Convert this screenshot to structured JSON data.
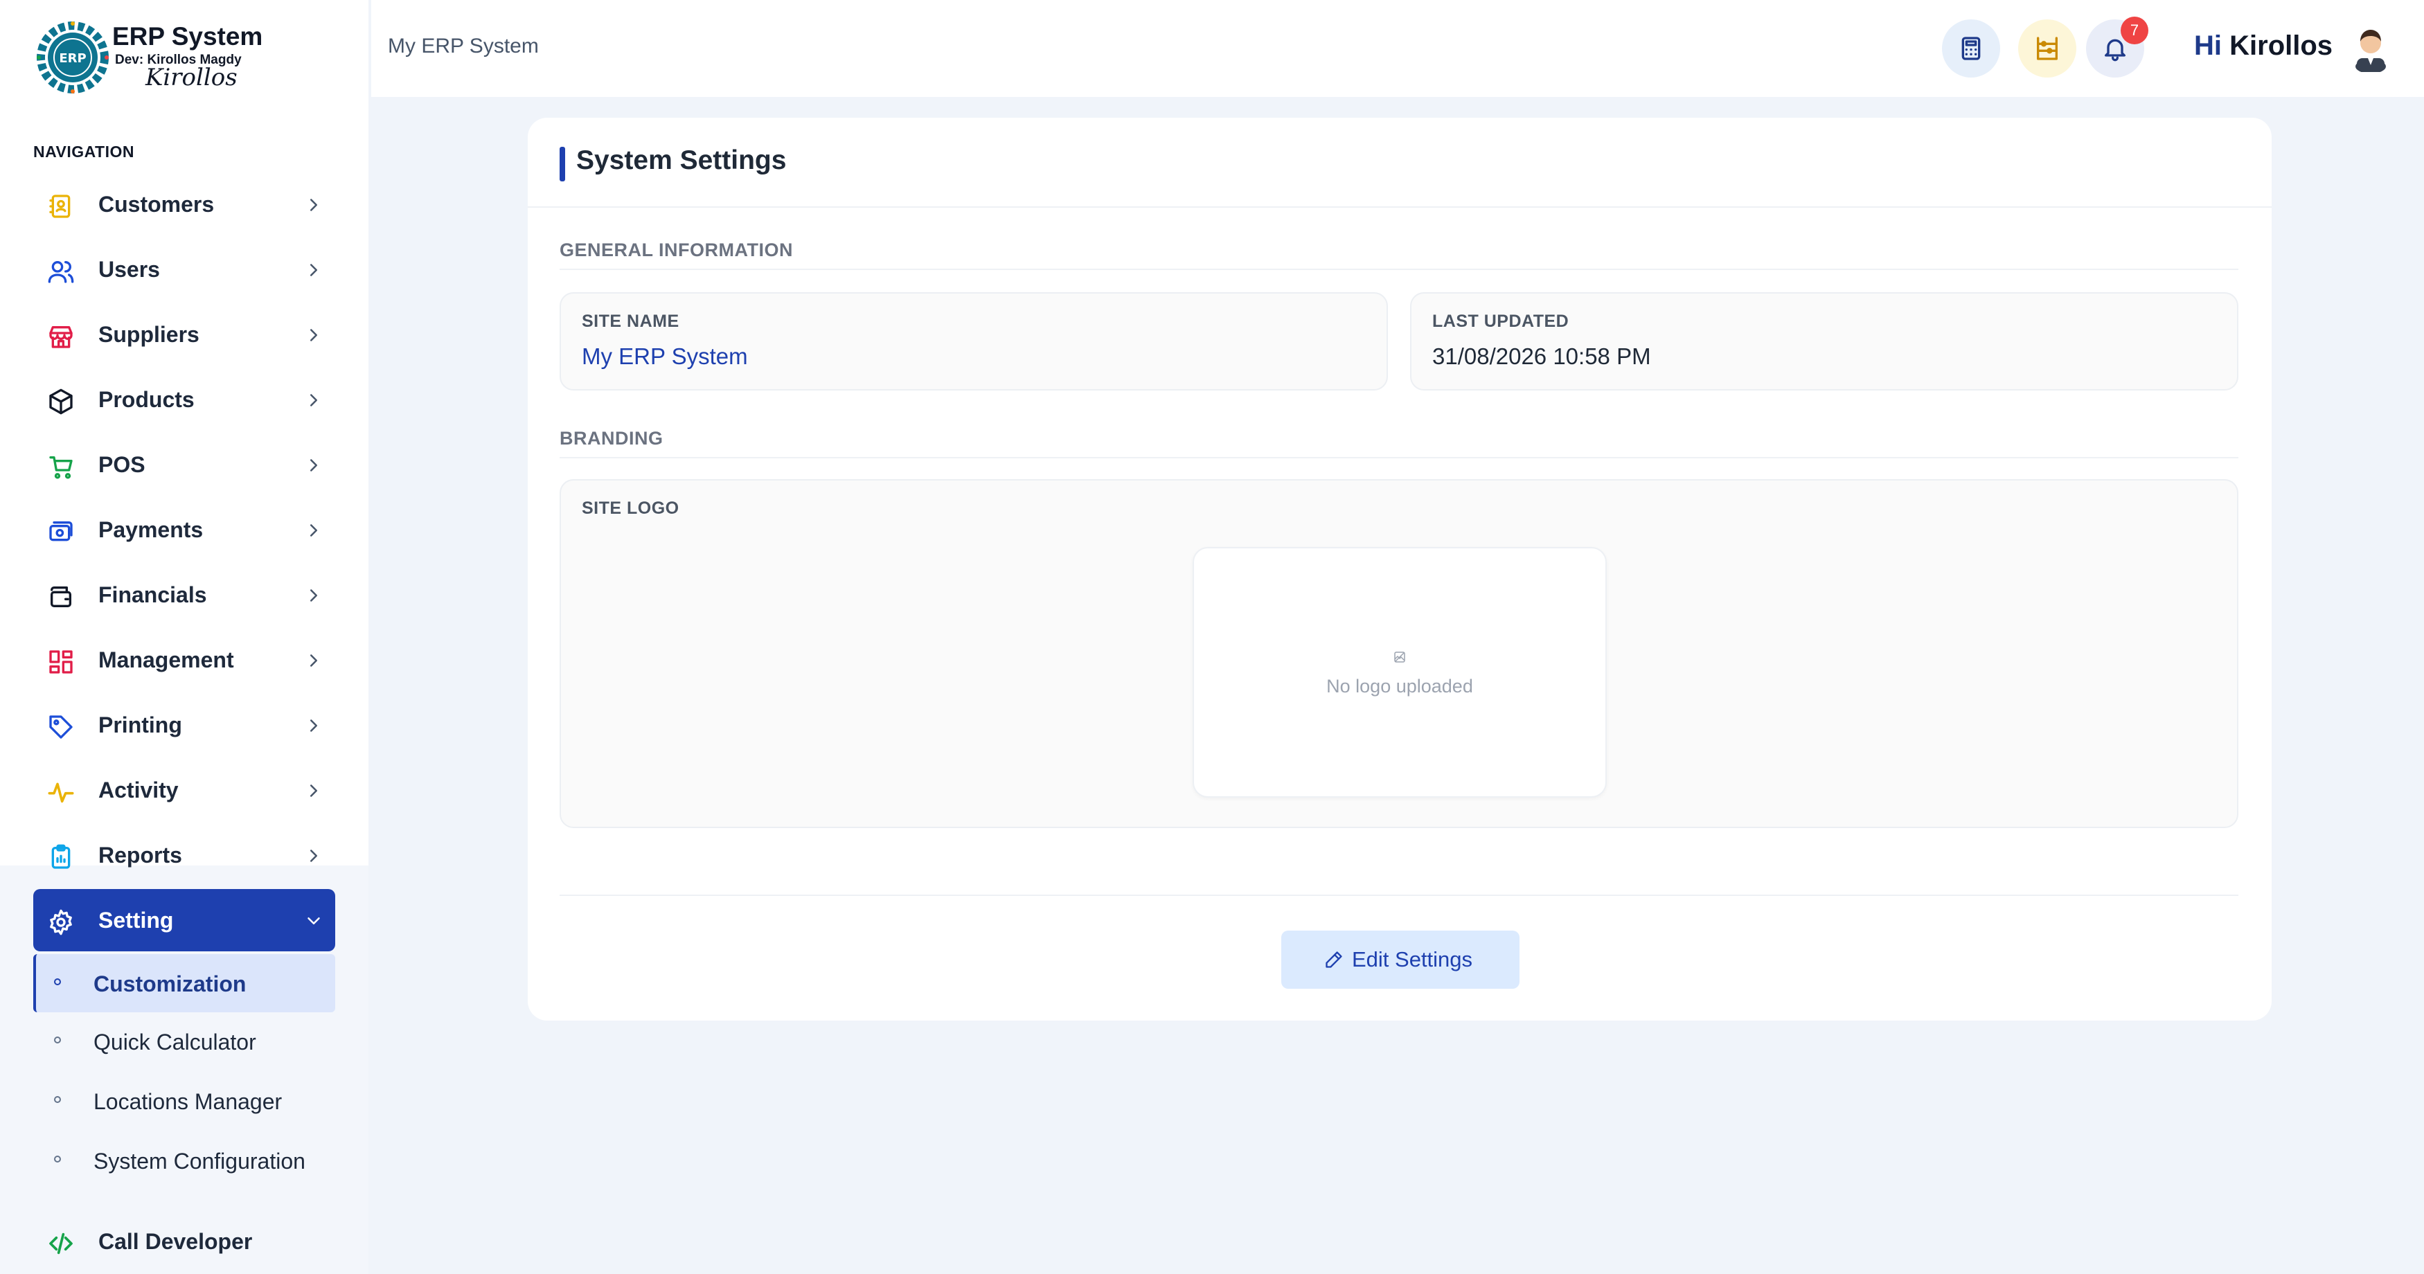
{
  "brand": {
    "title": "ERP System",
    "dev": "Dev: Kirollos Magdy",
    "signature": "Kirollos",
    "logo_text": "ERP"
  },
  "sidebar": {
    "heading": "NAVIGATION",
    "items": [
      {
        "label": "Customers",
        "icon": "contact-book-icon",
        "color": "#eab308"
      },
      {
        "label": "Users",
        "icon": "users-icon",
        "color": "#1d4ed8"
      },
      {
        "label": "Suppliers",
        "icon": "store-icon",
        "color": "#e11d48"
      },
      {
        "label": "Products",
        "icon": "box-icon",
        "color": "#111827"
      },
      {
        "label": "POS",
        "icon": "cart-icon",
        "color": "#16a34a"
      },
      {
        "label": "Payments",
        "icon": "payment-card-icon",
        "color": "#1d4ed8"
      },
      {
        "label": "Financials",
        "icon": "wallet-icon",
        "color": "#111827"
      },
      {
        "label": "Management",
        "icon": "dashboard-grid-icon",
        "color": "#e11d48"
      },
      {
        "label": "Printing",
        "icon": "tag-icon",
        "color": "#1d4ed8"
      },
      {
        "label": "Activity",
        "icon": "activity-pulse-icon",
        "color": "#eab308"
      },
      {
        "label": "Reports",
        "icon": "clipboard-icon",
        "color": "#0ea5e9"
      },
      {
        "label": "Setting",
        "icon": "gear-icon",
        "color": "#ffffff"
      }
    ],
    "sub_items": [
      {
        "label": "Customization"
      },
      {
        "label": "Quick Calculator"
      },
      {
        "label": "Locations Manager"
      },
      {
        "label": "System Configuration"
      }
    ],
    "call_developer": {
      "label": "Call Developer",
      "icon": "code-icon",
      "color": "#16a34a"
    }
  },
  "header": {
    "title": "My ERP System",
    "notification_count": "7",
    "greeting_hi": "Hi",
    "greeting_name": "Kirollos"
  },
  "card": {
    "title": "System Settings",
    "general_label": "GENERAL INFORMATION",
    "site_name_label": "SITE NAME",
    "site_name_value": "My ERP System",
    "last_updated_label": "LAST UPDATED",
    "last_updated_value": "31/08/2026 10:58 PM",
    "branding_label": "BRANDING",
    "site_logo_label": "SITE LOGO",
    "no_logo_text": "No logo uploaded",
    "edit_button": "Edit Settings"
  },
  "colors": {
    "accent": "#1e40af",
    "link": "#1e40af",
    "badge": "#ef4444",
    "page_bg": "#f0f4fa"
  }
}
